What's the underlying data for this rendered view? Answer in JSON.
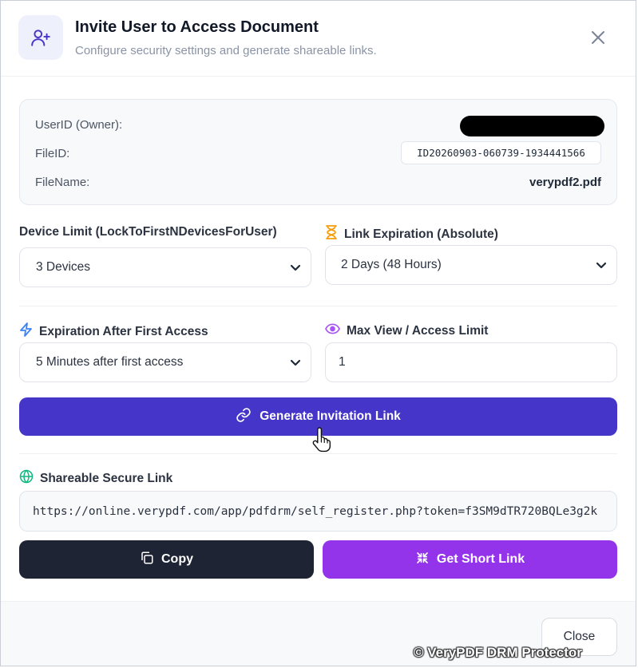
{
  "header": {
    "title": "Invite User to Access Document",
    "subtitle": "Configure security settings and generate shareable links.",
    "icon": "user-plus-icon"
  },
  "info": {
    "owner_label": "UserID (Owner):",
    "fileid_label": "FileID:",
    "fileid_value": "ID20260903-060739-1934441566",
    "filename_label": "FileName:",
    "filename_value": "verypdf2.pdf"
  },
  "form": {
    "device_limit": {
      "label": "Device Limit (LockToFirstNDevicesForUser)",
      "value": "3 Devices"
    },
    "link_expiration": {
      "label": "Link Expiration (Absolute)",
      "value": "2 Days (48 Hours)",
      "icon": "hourglass-icon"
    },
    "first_access": {
      "label": "Expiration After First Access",
      "value": "5 Minutes after first access",
      "icon": "lightning-icon"
    },
    "max_view": {
      "label": "Max View / Access Limit",
      "value": "1",
      "icon": "eye-icon"
    }
  },
  "actions": {
    "generate_label": "Generate Invitation Link",
    "share_label": "Shareable Secure Link",
    "share_link": "https://online.verypdf.com/app/pdfdrm/self_register.php?token=f3SM9dTR720BQLe3g2k",
    "copy_label": "Copy",
    "short_label": "Get Short Link"
  },
  "footer": {
    "close_label": "Close"
  },
  "watermark": "© VeryPDF DRM Protector",
  "colors": {
    "primary": "#4536c9",
    "purple": "#9333ea",
    "dark": "#1e2433",
    "hourglass": "#f59e0b",
    "lightning": "#3b82f6",
    "eye": "#a855f7",
    "globe": "#10b981"
  }
}
